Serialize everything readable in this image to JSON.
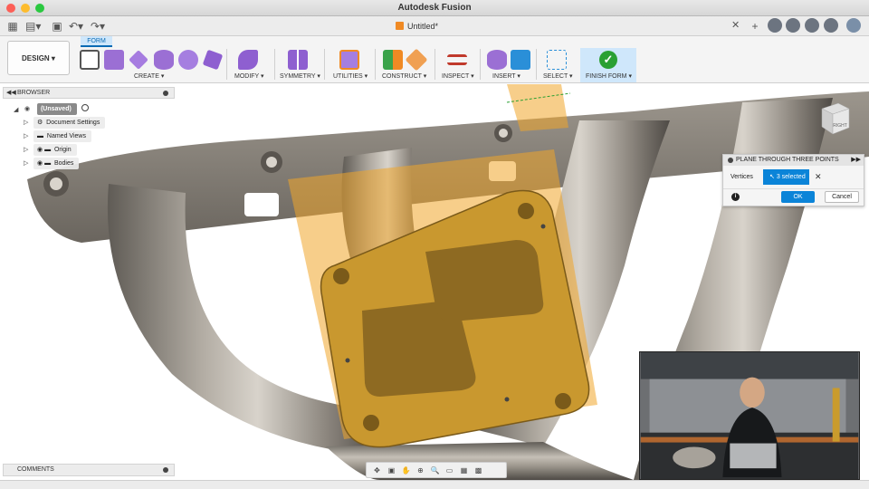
{
  "window": {
    "title": "Autodesk Fusion"
  },
  "document_tab": {
    "label": "Untitled*"
  },
  "ribbon": {
    "workspace_label": "DESIGN",
    "active_tab": "FORM",
    "groups": [
      {
        "label": "CREATE",
        "has_menu": true
      },
      {
        "label": "MODIFY",
        "has_menu": true
      },
      {
        "label": "SYMMETRY",
        "has_menu": true
      },
      {
        "label": "UTILITIES",
        "has_menu": true
      },
      {
        "label": "CONSTRUCT",
        "has_menu": true
      },
      {
        "label": "INSPECT",
        "has_menu": true
      },
      {
        "label": "INSERT",
        "has_menu": true
      },
      {
        "label": "SELECT",
        "has_menu": true
      },
      {
        "label": "FINISH FORM",
        "has_menu": true
      }
    ]
  },
  "browser": {
    "header": "BROWSER",
    "root": "(Unsaved)",
    "items": [
      {
        "label": "Document Settings",
        "icon": "gear-icon"
      },
      {
        "label": "Named Views",
        "icon": "folder-icon"
      },
      {
        "label": "Origin",
        "icon": "folder-icon"
      },
      {
        "label": "Bodies",
        "icon": "folder-icon"
      }
    ]
  },
  "comments": {
    "header": "COMMENTS"
  },
  "dialog": {
    "title": "PLANE THROUGH THREE POINTS",
    "field_label": "Vertices",
    "selection_text": "3 selected",
    "ok_label": "OK",
    "cancel_label": "Cancel"
  },
  "viewcube": {
    "face_label": "RIGHT"
  },
  "colors": {
    "accent_blue": "#0b84d8",
    "finish_green": "#2aa033",
    "plane_orange": "#f0a52a"
  }
}
